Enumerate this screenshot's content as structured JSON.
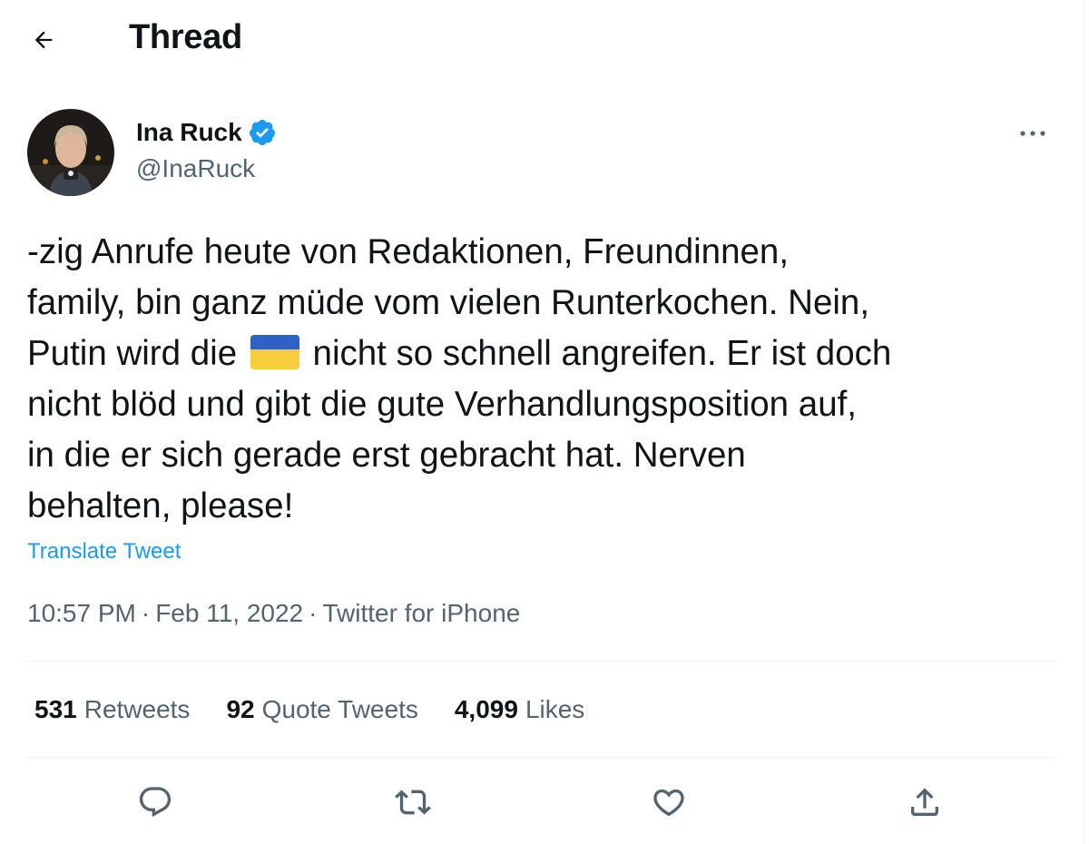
{
  "header": {
    "title": "Thread",
    "back_icon": "arrow-left-icon"
  },
  "author": {
    "name": "Ina Ruck",
    "handle": "@InaRuck",
    "verified_icon": "verified-badge-icon",
    "verified_color": "#1d9bf0"
  },
  "tweet": {
    "lines": [
      "-zig Anrufe heute von Redaktionen, Freundinnen,",
      "family, bin ganz müde vom vielen Runterkochen. Nein,",
      "Putin wird die",
      "nicht so schnell angreifen. Er ist doch",
      "nicht blöd und gibt die gute Verhandlungsposition auf,",
      "in die er sich gerade erst gebracht hat. Nerven",
      "behalten, please!"
    ],
    "flag_emoji": "ukraine-flag-emoji",
    "translate_label": "Translate Tweet"
  },
  "meta": {
    "time": "10:57 PM",
    "separator": "·",
    "date": "Feb 11, 2022",
    "source": "Twitter for iPhone"
  },
  "stats": {
    "retweets_count": "531",
    "retweets_label": "Retweets",
    "quotes_count": "92",
    "quotes_label": "Quote Tweets",
    "likes_count": "4,099",
    "likes_label": "Likes"
  },
  "actions": [
    {
      "icon": "reply-icon"
    },
    {
      "icon": "retweet-icon"
    },
    {
      "icon": "like-heart-icon"
    },
    {
      "icon": "share-icon"
    }
  ],
  "colors": {
    "text": "#0f1419",
    "secondary": "#536471",
    "link": "#1d9bf0",
    "divider": "#eff3f4",
    "flag_blue": "#2e63c4",
    "flag_yellow": "#f6cd3a"
  }
}
